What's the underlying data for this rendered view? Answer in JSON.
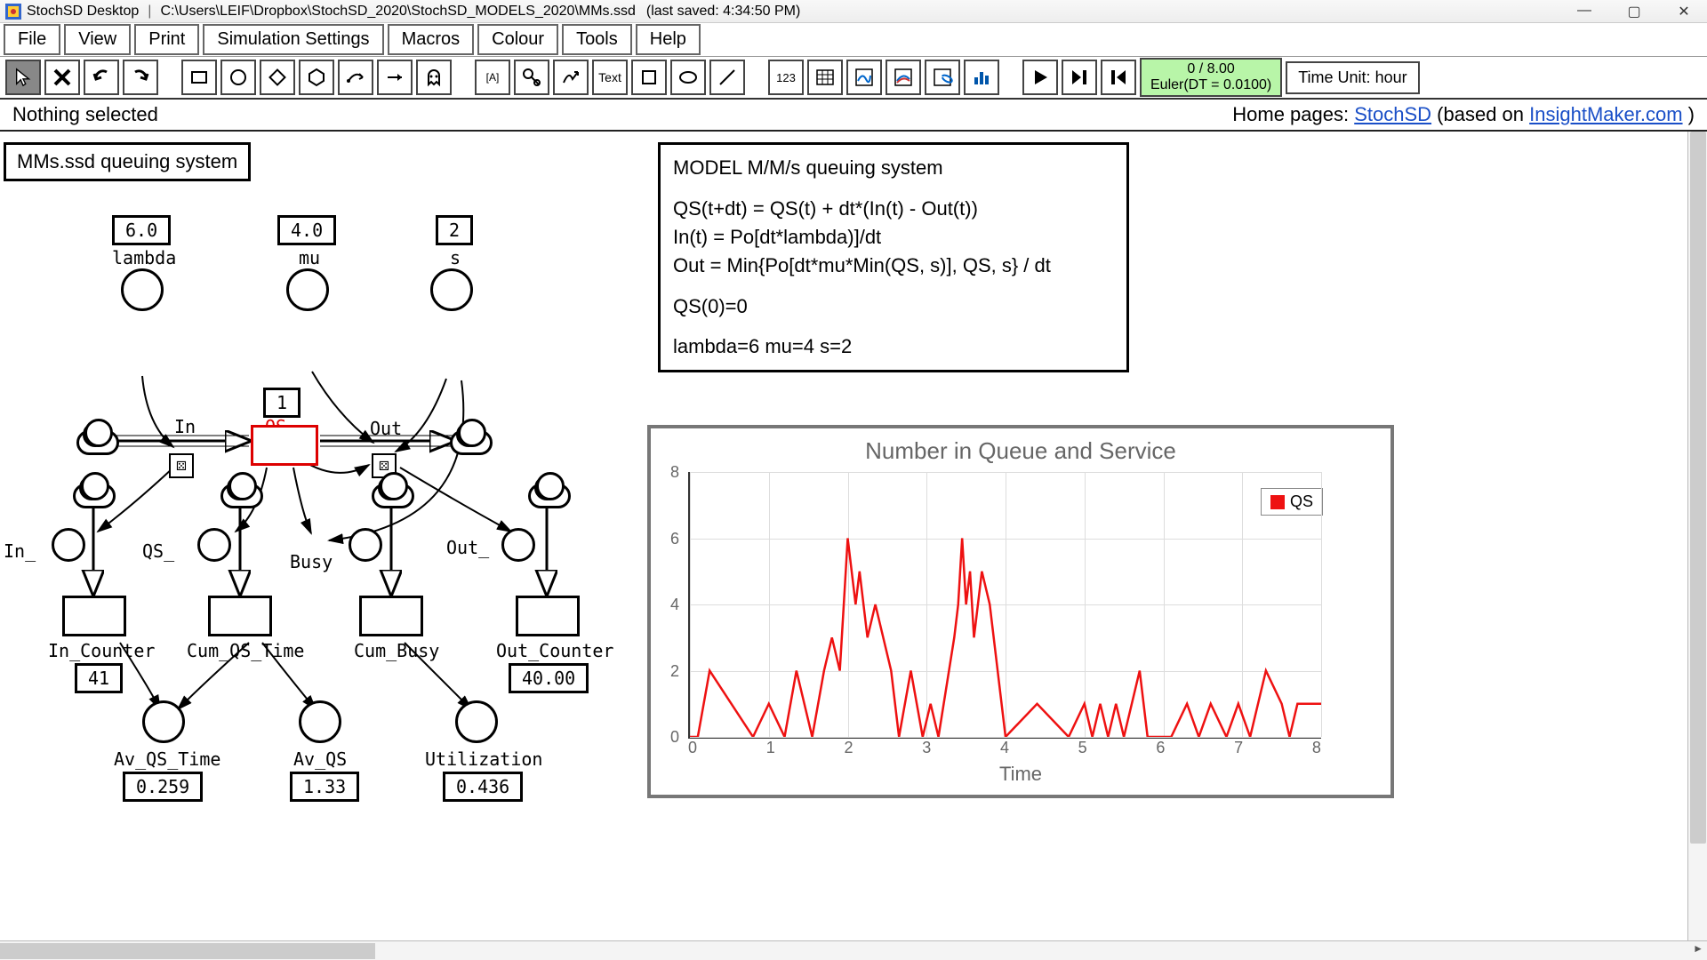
{
  "window": {
    "app_name": "StochSD Desktop",
    "file_path": "C:\\Users\\LEIF\\Dropbox\\StochSD_2020\\StochSD_MODELS_2020\\MMs.ssd",
    "last_saved": "(last saved: 4:34:50 PM)"
  },
  "menu": {
    "file": "File",
    "view": "View",
    "print": "Print",
    "sim_settings": "Simulation Settings",
    "macros": "Macros",
    "colour": "Colour",
    "tools": "Tools",
    "help": "Help"
  },
  "toolbar": {
    "text_tool": "Text",
    "num_tool": "123",
    "var_tool": "[A]"
  },
  "sim": {
    "progress": "0 / 8.00",
    "method": "Euler(DT = 0.0100)",
    "time_unit": "Time Unit: hour"
  },
  "subbar": {
    "selection": "Nothing selected",
    "home_label": "Home pages: ",
    "link1": "StochSD",
    "between": " (based on ",
    "link2": "InsightMaker.com",
    "after": ")"
  },
  "model": {
    "title": "MMs.ssd queuing system",
    "desc_heading": "MODEL M/M/s queuing system",
    "eq1": "QS(t+dt) = QS(t) + dt*(In(t) - Out(t))",
    "eq2": "In(t) = Po[dt*lambda)]/dt",
    "eq3": "Out = Min{Po[dt*mu*Min(QS, s)], QS, s} / dt",
    "eq4": "QS(0)=0",
    "eq5": "lambda=6  mu=4  s=2",
    "params": {
      "lambda_val": "6.0",
      "lambda_lbl": "lambda",
      "mu_val": "4.0",
      "mu_lbl": "mu",
      "s_val": "2",
      "s_lbl": "s",
      "qs_init": "1",
      "qs_lbl": "QS",
      "in_lbl": "In",
      "out_lbl": "Out",
      "in_bottom": "In_",
      "qs_bottom": "QS_",
      "busy": "Busy",
      "out_bottom": "Out_",
      "in_counter_lbl": "In_Counter",
      "in_counter_val": "41",
      "cum_qs_lbl": "Cum_QS_Time",
      "cum_busy_lbl": "Cum_Busy",
      "out_counter_lbl": "Out_Counter",
      "out_counter_val": "40.00",
      "av_qs_time_lbl": "Av_QS_Time",
      "av_qs_time_val": "0.259",
      "av_qs_lbl": "Av_QS",
      "av_qs_val": "1.33",
      "util_lbl": "Utilization",
      "util_val": "0.436"
    }
  },
  "chart_data": {
    "type": "line",
    "title": "Number in Queue and Service",
    "xlabel": "Time",
    "ylabel": "",
    "xlim": [
      0,
      8
    ],
    "ylim": [
      0,
      8
    ],
    "xticks": [
      0,
      1,
      2,
      3,
      4,
      5,
      6,
      7,
      8
    ],
    "yticks": [
      0,
      2,
      4,
      6,
      8
    ],
    "legend": [
      "QS"
    ],
    "series": [
      {
        "name": "QS",
        "color": "#e11",
        "x": [
          0.0,
          0.1,
          0.25,
          0.25,
          0.8,
          0.8,
          1.0,
          1.0,
          1.2,
          1.2,
          1.35,
          1.35,
          1.45,
          1.45,
          1.55,
          1.55,
          1.7,
          1.7,
          1.8,
          1.8,
          1.9,
          1.9,
          1.95,
          1.95,
          2.0,
          2.0,
          2.05,
          2.05,
          2.1,
          2.1,
          2.15,
          2.15,
          2.25,
          2.25,
          2.35,
          2.35,
          2.45,
          2.45,
          2.55,
          2.55,
          2.65,
          2.65,
          2.8,
          2.8,
          2.95,
          2.95,
          3.05,
          3.05,
          3.15,
          3.15,
          3.35,
          3.35,
          3.4,
          3.4,
          3.45,
          3.45,
          3.5,
          3.5,
          3.55,
          3.55,
          3.6,
          3.6,
          3.7,
          3.7,
          3.8,
          3.8,
          3.9,
          3.9,
          4.0,
          4.0,
          4.4,
          4.4,
          4.8,
          4.8,
          5.0,
          5.0,
          5.1,
          5.1,
          5.2,
          5.2,
          5.3,
          5.3,
          5.4,
          5.4,
          5.5,
          5.5,
          5.7,
          5.7,
          5.8,
          5.8,
          6.1,
          6.1,
          6.3,
          6.3,
          6.45,
          6.45,
          6.6,
          6.6,
          6.8,
          6.8,
          6.95,
          6.95,
          7.1,
          7.1,
          7.3,
          7.3,
          7.5,
          7.5,
          7.6,
          7.6,
          7.7,
          7.7,
          8.0
        ],
        "y": [
          0,
          0,
          2,
          2,
          0,
          0,
          1,
          1,
          0,
          0,
          2,
          2,
          1,
          1,
          0,
          0,
          2,
          2,
          3,
          3,
          2,
          2,
          4,
          4,
          6,
          6,
          5,
          5,
          4,
          4,
          5,
          5,
          3,
          3,
          4,
          4,
          3,
          3,
          2,
          2,
          0,
          0,
          2,
          2,
          0,
          0,
          1,
          1,
          0,
          0,
          3,
          3,
          4,
          4,
          6,
          6,
          4,
          4,
          5,
          5,
          3,
          3,
          5,
          5,
          4,
          4,
          2,
          2,
          0,
          0,
          1,
          1,
          0,
          0,
          1,
          1,
          0,
          0,
          1,
          1,
          0,
          0,
          1,
          1,
          0,
          0,
          2,
          2,
          0,
          0,
          0,
          0,
          1,
          1,
          0,
          0,
          1,
          1,
          0,
          0,
          1,
          1,
          0,
          0,
          2,
          2,
          1,
          1,
          0,
          0,
          1,
          1,
          1
        ]
      }
    ]
  }
}
